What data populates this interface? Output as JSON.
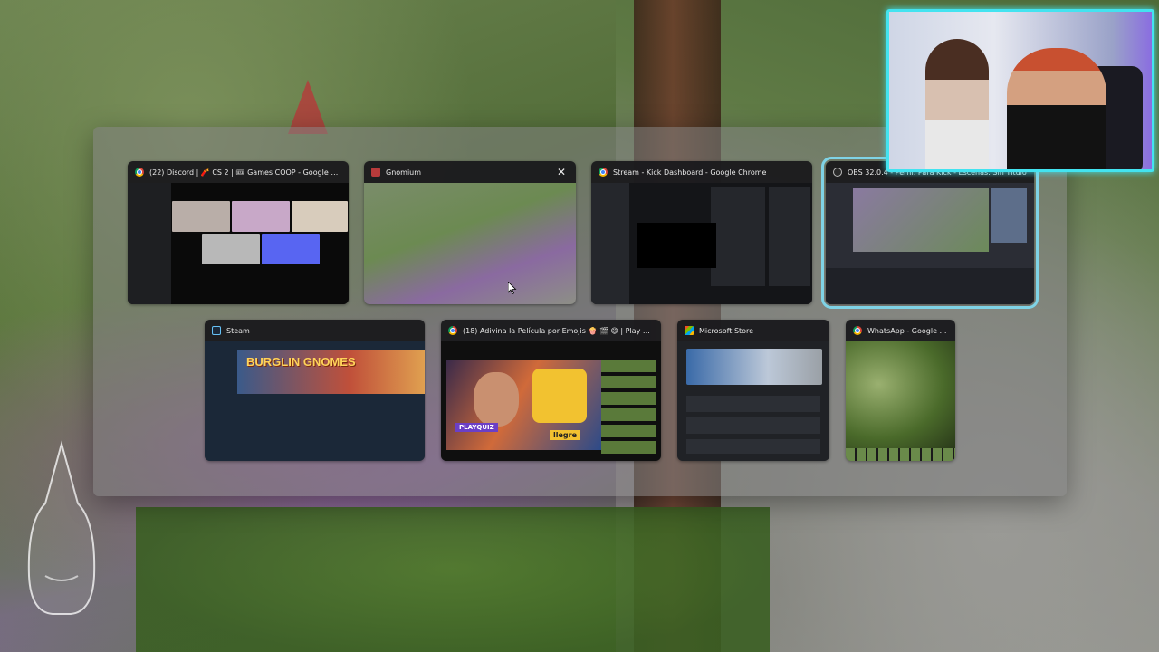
{
  "switcher": {
    "windows": [
      {
        "title": "(22) Discord | 🧨 CS 2 | 🎟 Games COOP - Google Chrome",
        "app": "chrome",
        "selected": false,
        "has_close": false
      },
      {
        "title": "Gnomium",
        "app": "gnome",
        "selected": false,
        "has_close": true
      },
      {
        "title": "Stream - Kick Dashboard - Google Chrome",
        "app": "chrome",
        "selected": false,
        "has_close": false
      },
      {
        "title": "OBS 32.0.4 - Perfil: Para Kick - Escenas: Sin Título",
        "app": "obs",
        "selected": true,
        "has_close": false
      },
      {
        "title": "Steam",
        "app": "steam",
        "selected": false,
        "has_close": false
      },
      {
        "title": "(18) Adivina la Película por Emojis 🍿 🎬 😄 | Play Quiz de...",
        "app": "chrome",
        "selected": false,
        "has_close": false
      },
      {
        "title": "Microsoft Store",
        "app": "store",
        "selected": false,
        "has_close": false
      },
      {
        "title": "WhatsApp - Google Ch...",
        "app": "chrome",
        "selected": false,
        "has_close": false
      }
    ],
    "close_glyph": "✕"
  },
  "thumbnails": {
    "steam_banner_text": "BURGLIN GNOMES",
    "youtube_badge": "PLAYQUIZ",
    "youtube_caption": "llegre"
  },
  "colors": {
    "selection_outline": "#7fd3e6",
    "webcam_border": "#43e3f0"
  },
  "icons": [
    "chrome-icon",
    "gnomium-icon",
    "obs-icon",
    "steam-icon",
    "microsoft-store-icon",
    "close-icon",
    "mouse-cursor-icon"
  ]
}
